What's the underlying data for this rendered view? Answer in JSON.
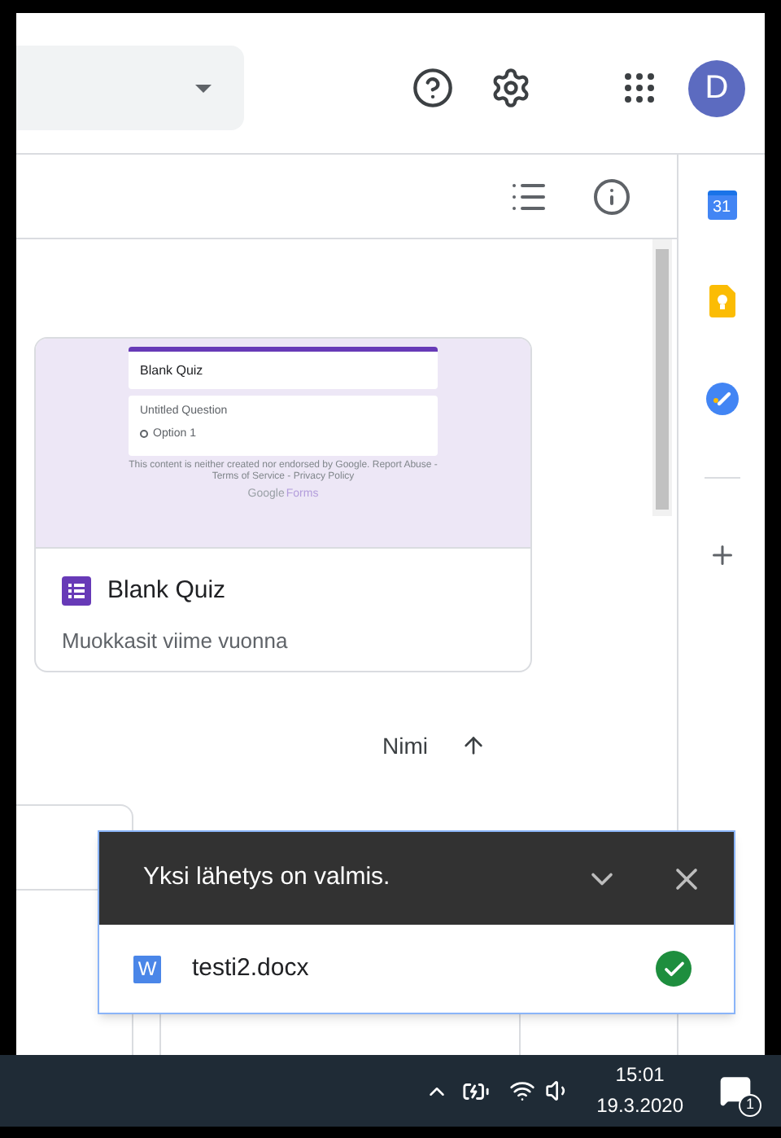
{
  "account": {
    "initial": "D"
  },
  "card": {
    "preview": {
      "title": "Blank Quiz",
      "question": "Untitled Question",
      "option": "Option 1",
      "footer": "This content is neither created nor endorsed by Google. Report Abuse - Terms of Service - Privacy Policy",
      "brand": "Google",
      "product": "Forms"
    },
    "title": "Blank Quiz",
    "subtitle": "Muokkasit viime vuonna"
  },
  "sort": {
    "label": "Nimi"
  },
  "side_panel": {
    "calendar_day": "31"
  },
  "upload_panel": {
    "title": "Yksi lähetys on valmis.",
    "files": [
      {
        "name": "testi2.docx",
        "icon_letter": "W",
        "done": true
      }
    ]
  },
  "taskbar": {
    "time": "15:01",
    "date": "19.3.2020",
    "notifications": "1"
  }
}
